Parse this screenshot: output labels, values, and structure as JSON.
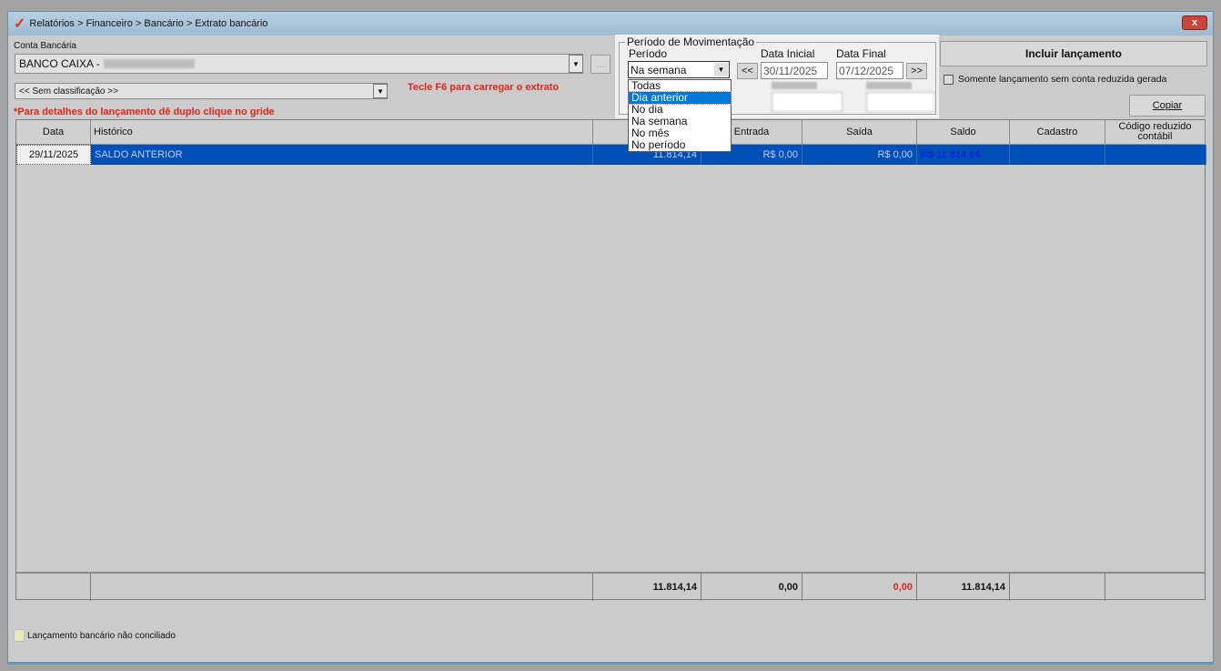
{
  "window": {
    "title": "Relatórios > Financeiro > Bancário > Extrato bancário",
    "close": "x"
  },
  "conta": {
    "label": "Conta Bancária",
    "value": "BANCO CAIXA -",
    "browse": "..."
  },
  "classificacao": {
    "value": "<< Sem classificação >>"
  },
  "hints": {
    "f6": "Tecle F6 para carregar o extrato",
    "detalhes": "*Para detalhes do lançamento dê duplo clique no gride"
  },
  "periodo": {
    "group": "Período de Movimentação",
    "label": "Período",
    "value": "Na semana",
    "prev": "<<",
    "next": ">>",
    "data_inicial_label": "Data Inicial",
    "data_inicial": "30/11/2025",
    "data_final_label": "Data Final",
    "data_final": "07/12/2025",
    "options": [
      "Todas",
      "Dia anterior",
      "No dia",
      "Na semana",
      "No mês",
      "No período"
    ],
    "highlighted": "Dia anterior"
  },
  "actions": {
    "incluir": "Incluir lançamento",
    "somente": "Somente lançamento sem conta reduzida gerada",
    "somente_checked": false,
    "copiar": "Copiar"
  },
  "grid": {
    "headers": [
      "Data",
      "Histórico",
      "",
      "Entrada",
      "Saída",
      "Saldo",
      "Cadastro",
      "Código reduzido contábil"
    ],
    "rows": [
      {
        "data": "29/11/2025",
        "historico": "SALDO ANTERIOR",
        "col3": "11.814,14",
        "entrada": "R$ 0,00",
        "saida": "R$ 0,00",
        "saldo": "R$ 11.814,14",
        "cadastro": "",
        "codigo": ""
      }
    ],
    "totals": {
      "col3": "11.814,14",
      "entrada": "0,00",
      "saida": "0,00",
      "saldo": "11.814,14"
    }
  },
  "legend": {
    "label": "Lançamento bancário não conciliado",
    "color": "#e8e8c0"
  },
  "colors": {
    "selection": "#0050b8",
    "alert": "#e0241c"
  }
}
